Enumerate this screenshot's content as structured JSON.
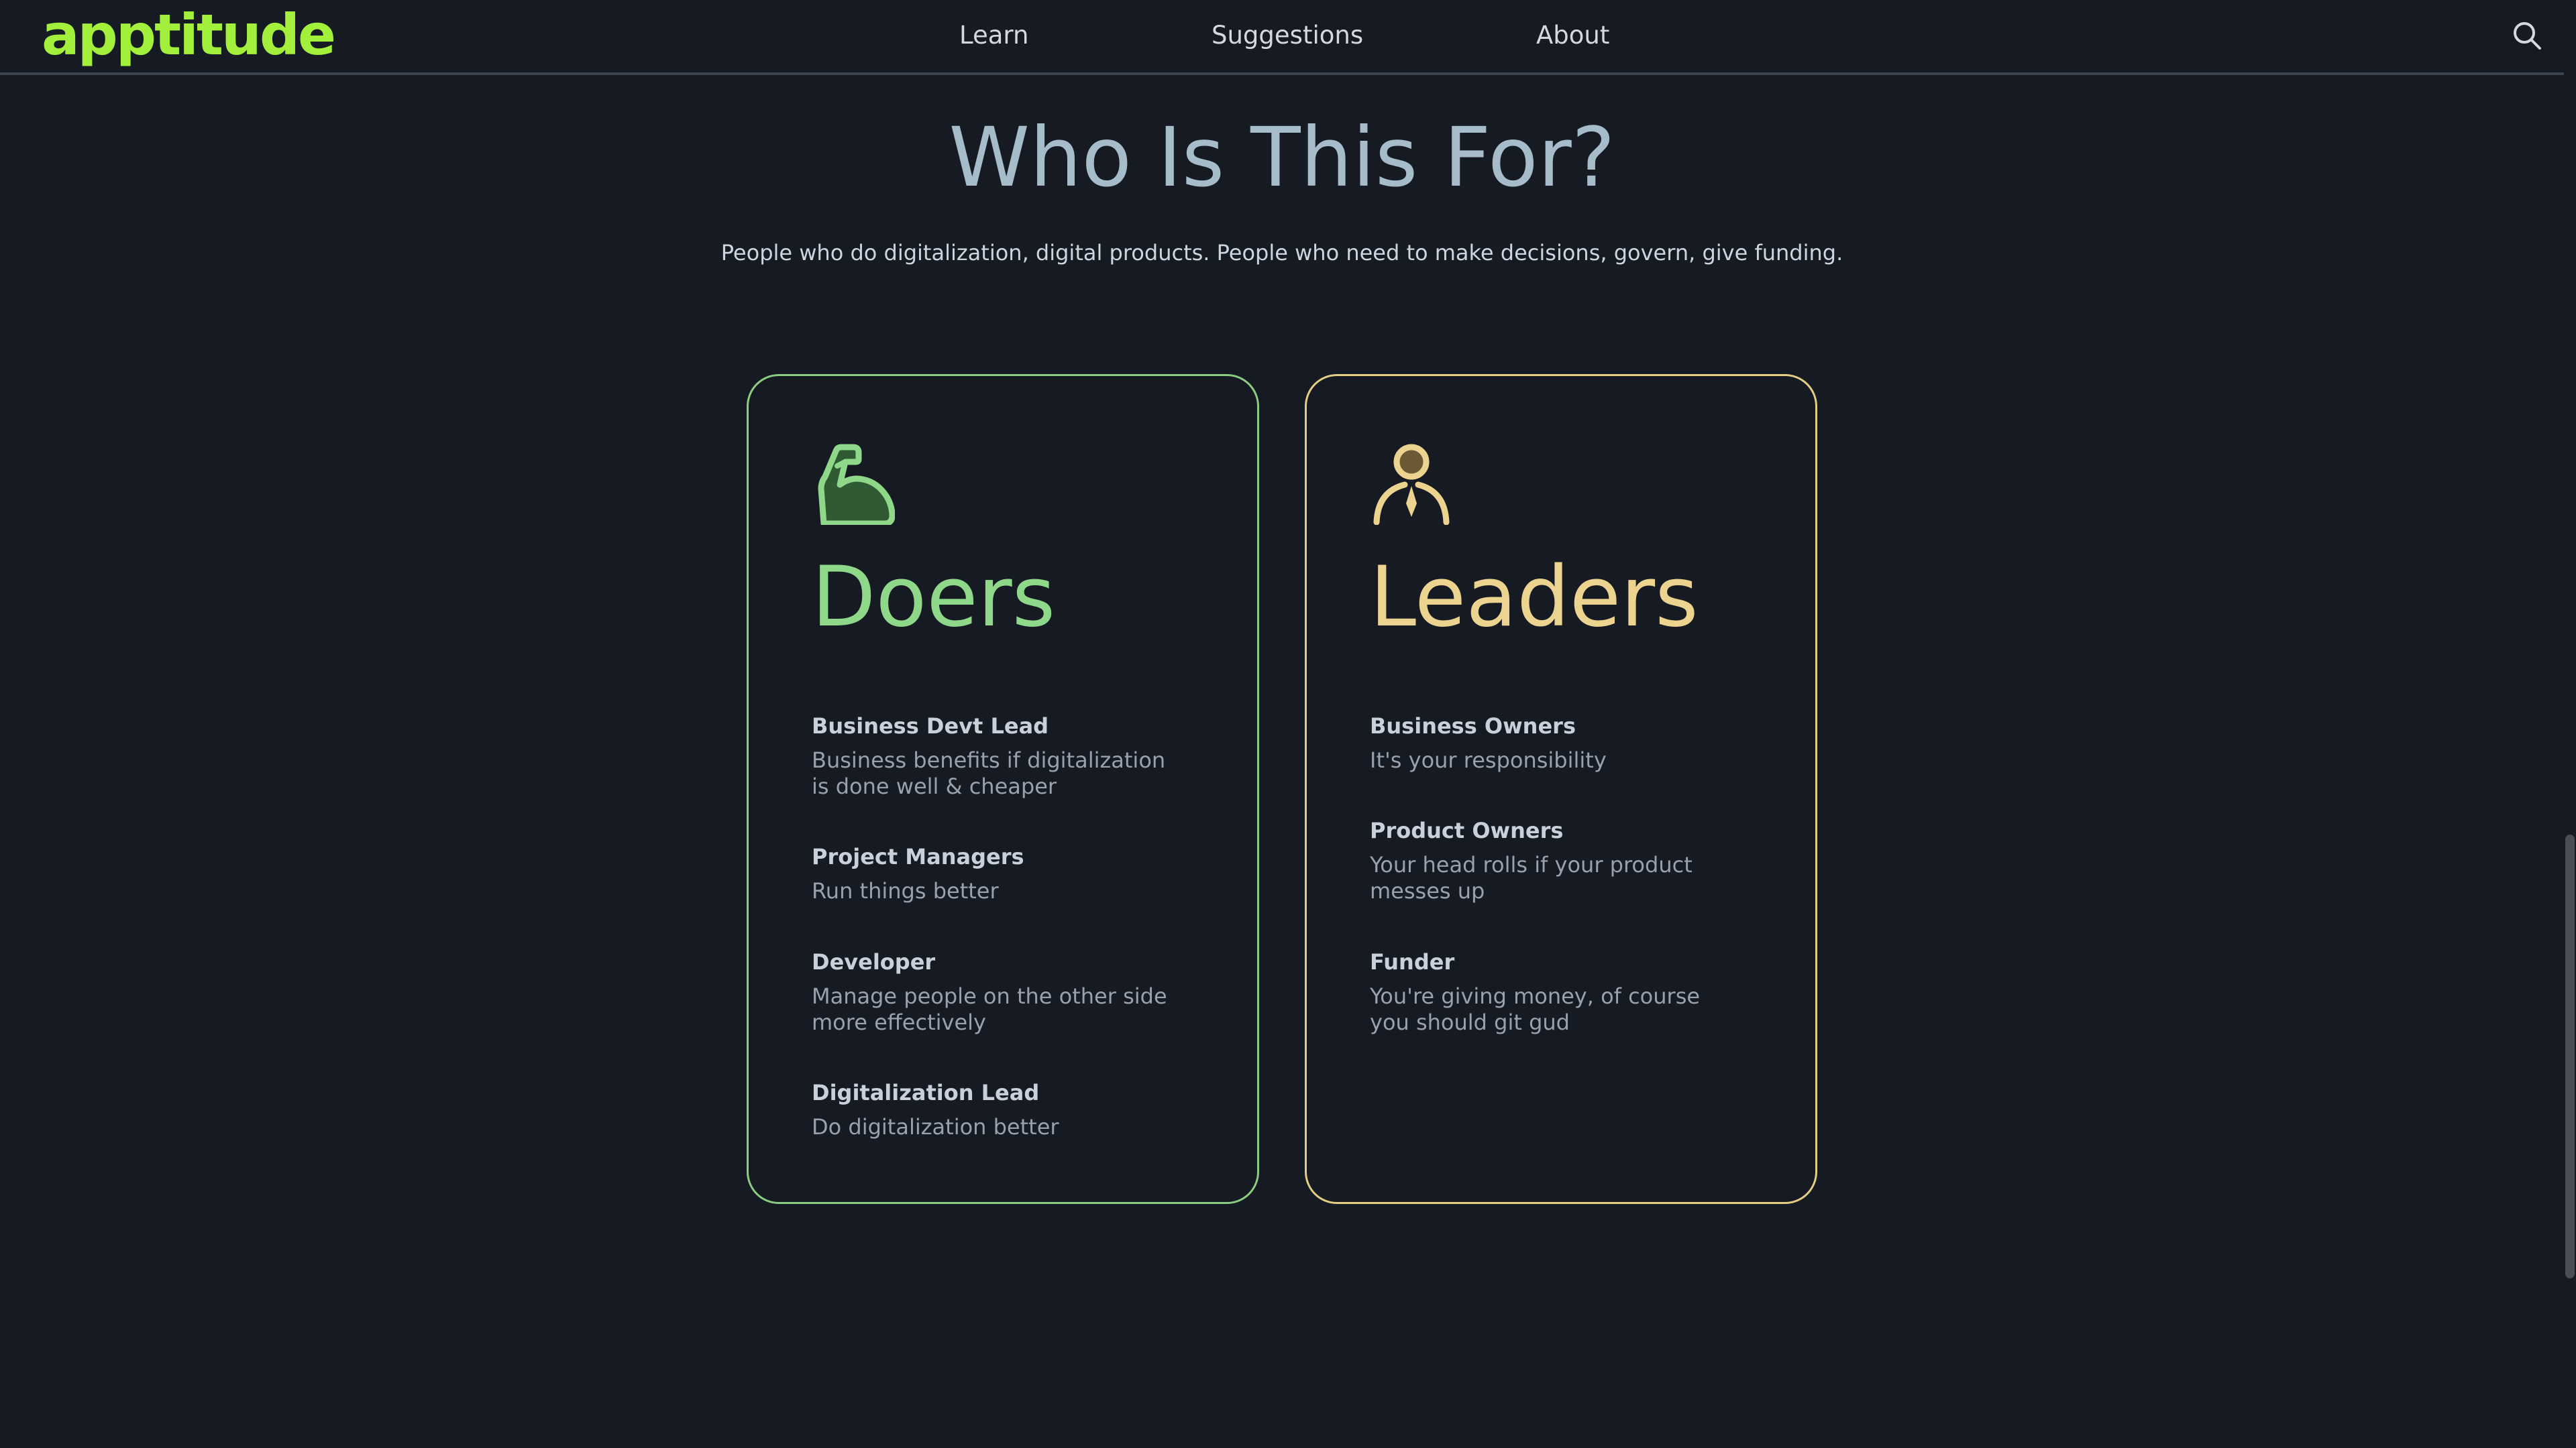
{
  "header": {
    "logo": "apptitude",
    "nav": [
      "Learn",
      "Suggestions",
      "About"
    ]
  },
  "section": {
    "title": "Who Is This For?",
    "subtitle": "People who do digitalization, digital products. People who need to make decisions, govern, give funding."
  },
  "cards": [
    {
      "title": "Doers",
      "icon": "flexed-arm-icon",
      "accent": "#8bcd80",
      "roles": [
        {
          "name": "Business Devt Lead",
          "desc": "Business benefits if digitalization is done well & cheaper"
        },
        {
          "name": "Project Managers",
          "desc": "Run things better"
        },
        {
          "name": "Developer",
          "desc": "Manage people on the other side more effectively"
        },
        {
          "name": "Digitalization Lead",
          "desc": "Do digitalization better"
        }
      ]
    },
    {
      "title": "Leaders",
      "icon": "person-with-tie-icon",
      "accent": "#e6cd84",
      "roles": [
        {
          "name": "Business Owners",
          "desc": "It's your responsibility"
        },
        {
          "name": "Product Owners",
          "desc": "Your head rolls if your product messes up"
        },
        {
          "name": "Funder",
          "desc": "You're giving money, of course you should git gud"
        }
      ]
    }
  ],
  "colors": {
    "background": "#161a22",
    "logo": "#a3f03c",
    "doers": "#8bcd80",
    "leaders": "#e6cd84"
  }
}
